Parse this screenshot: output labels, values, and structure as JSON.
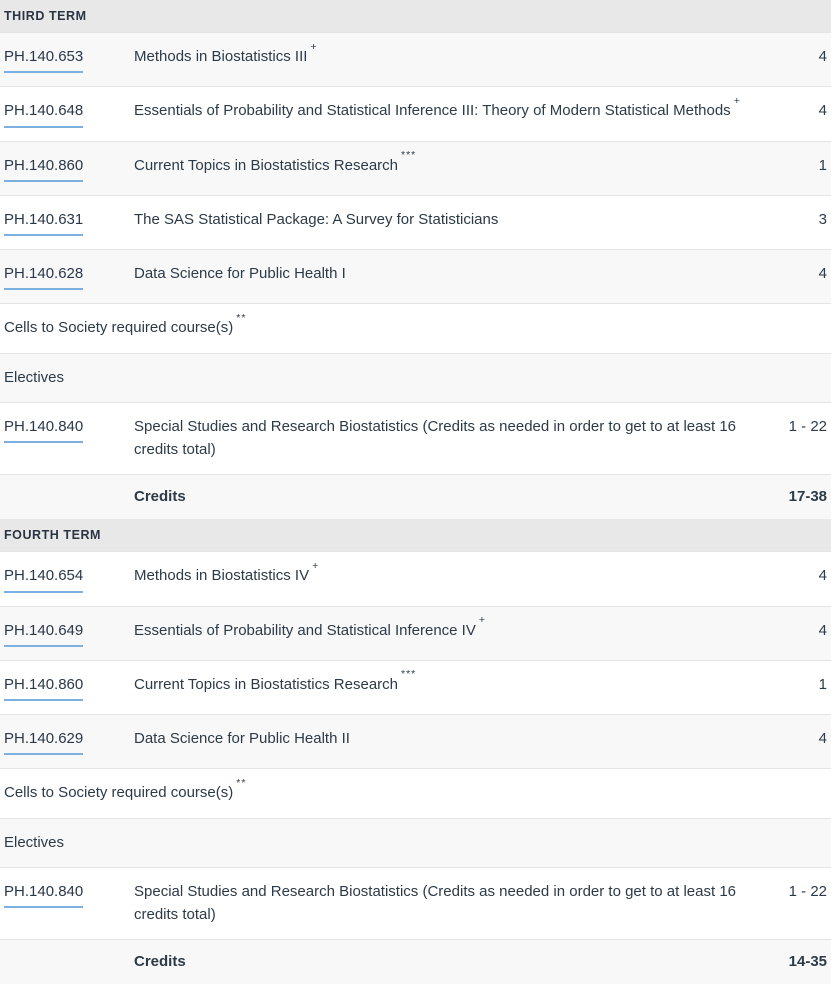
{
  "accent_colors": {
    "link_underline": "#7cb0de",
    "term_header_bg": "#e8e8e8",
    "row_shade_bg": "#f8f8f8",
    "row_plain_bg": "#ffffff",
    "row_border": "#e4e4e4",
    "text": "#2d3a47"
  },
  "table": {
    "credits_label": "Credits",
    "terms": [
      {
        "header": "THIRD TERM",
        "rows": [
          {
            "kind": "course",
            "code": "PH.140.653",
            "title": "Methods in Biostatistics III",
            "footnote": "+",
            "credits": "4",
            "shade": true
          },
          {
            "kind": "course",
            "code": "PH.140.648",
            "title": "Essentials of Probability and Statistical Inference III: Theory of Modern Statistical Methods",
            "footnote": "+",
            "credits": "4",
            "shade": false
          },
          {
            "kind": "course",
            "code": "PH.140.860",
            "title": "Current Topics in Biostatistics Research",
            "footnote": "***",
            "credits": "1",
            "shade": true
          },
          {
            "kind": "course",
            "code": "PH.140.631",
            "title": "The SAS Statistical Package: A Survey for Statisticians",
            "footnote": "",
            "credits": "3",
            "shade": false
          },
          {
            "kind": "course",
            "code": "PH.140.628",
            "title": "Data Science for Public Health I",
            "footnote": "",
            "credits": "4",
            "shade": true
          },
          {
            "kind": "label",
            "label": "Cells to Society required course(s)",
            "footnote": "**",
            "credits": "",
            "shade": false
          },
          {
            "kind": "label",
            "label": "Electives",
            "footnote": "",
            "credits": "",
            "shade": true
          },
          {
            "kind": "course",
            "code": "PH.140.840",
            "title": "Special Studies and Research Biostatistics (Credits as needed in order to get to at least 16 credits total)",
            "footnote": "",
            "credits": "1 - 22",
            "shade": false
          }
        ],
        "credits_total": "17-38"
      },
      {
        "header": "FOURTH TERM",
        "rows": [
          {
            "kind": "course",
            "code": "PH.140.654",
            "title": "Methods in Biostatistics IV",
            "footnote": "+",
            "credits": "4",
            "shade": false
          },
          {
            "kind": "course",
            "code": "PH.140.649",
            "title": "Essentials of Probability and Statistical Inference IV",
            "footnote": "+",
            "credits": "4",
            "shade": true
          },
          {
            "kind": "course",
            "code": "PH.140.860",
            "title": "Current Topics in Biostatistics Research",
            "footnote": "***",
            "credits": "1",
            "shade": false
          },
          {
            "kind": "course",
            "code": "PH.140.629",
            "title": "Data Science for Public Health II",
            "footnote": "",
            "credits": "4",
            "shade": true
          },
          {
            "kind": "label",
            "label": "Cells to Society required course(s)",
            "footnote": "**",
            "credits": "",
            "shade": false
          },
          {
            "kind": "label",
            "label": "Electives",
            "footnote": "",
            "credits": "",
            "shade": true
          },
          {
            "kind": "course",
            "code": "PH.140.840",
            "title": "Special Studies and Research Biostatistics (Credits as needed in order to get to at least 16 credits total)",
            "footnote": "",
            "credits": "1 - 22",
            "shade": false
          }
        ],
        "credits_total": "14-35"
      }
    ]
  }
}
